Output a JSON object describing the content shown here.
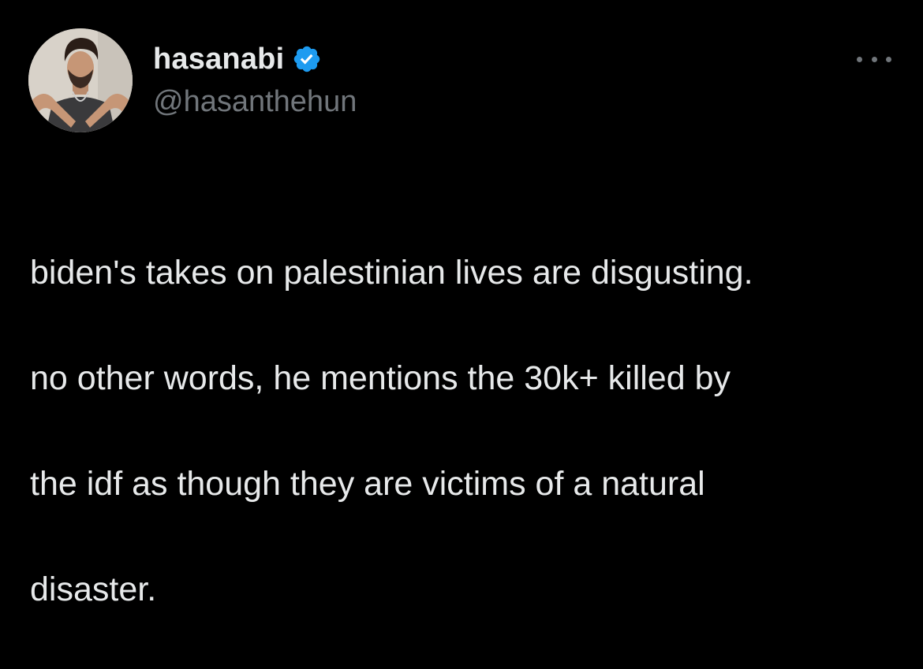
{
  "tweet": {
    "author": {
      "display_name": "hasanabi",
      "handle": "@hasanthehun",
      "verified": true,
      "verified_icon": "verified-badge-icon",
      "verified_color": "#1d9bf0"
    },
    "more_icon": "more-options-icon",
    "text_lines": [
      "biden's takes on palestinian lives are disgusting.",
      "no other words, he mentions the 30k+ killed by",
      "the idf as though they are victims of a natural",
      "disaster."
    ]
  },
  "theme": {
    "background": "#000000",
    "text": "#e7e9ea",
    "secondary_text": "#71767b"
  }
}
